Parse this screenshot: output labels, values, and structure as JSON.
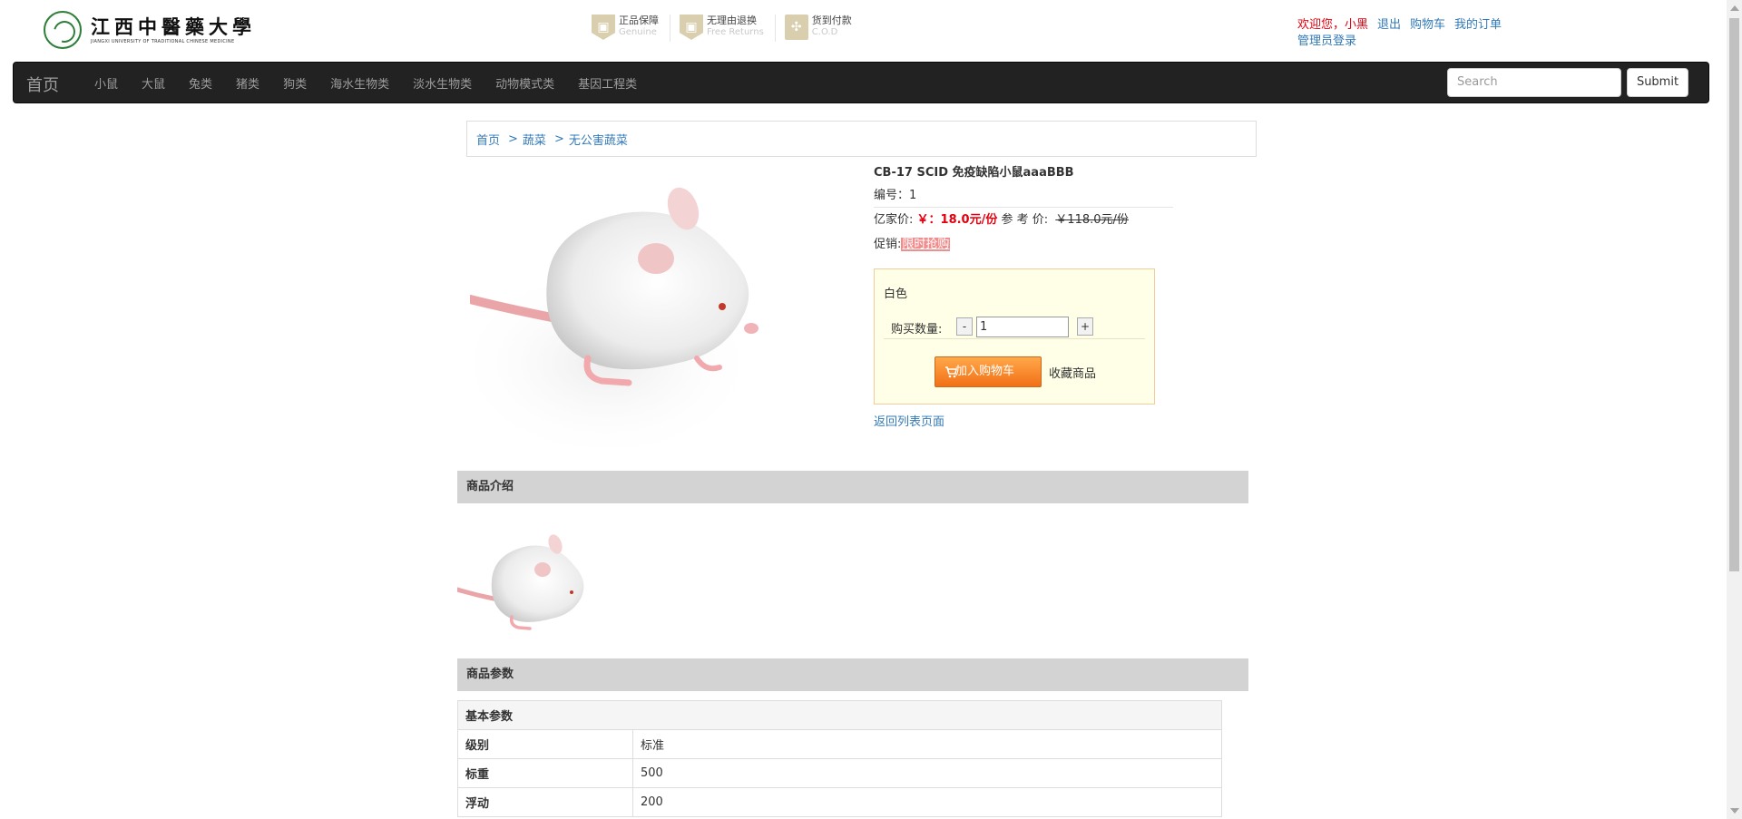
{
  "header": {
    "logo": {
      "name_cn": "江西中醫藥大學",
      "name_en": "JIANGXI UNIVERSITY OF TRADITIONAL CHINESE MEDICINE"
    },
    "guarantees": [
      {
        "icon": "shield-icon",
        "cn": "正品保障",
        "en": "Genuine"
      },
      {
        "icon": "shield-icon",
        "cn": "无理由退换",
        "en": "Free Returns"
      },
      {
        "icon": "cod-icon",
        "cn": "货到付款",
        "en": "C.O.D"
      }
    ],
    "user": {
      "welcome": "欢迎您，小黑",
      "logout": "退出",
      "cart": "购物车",
      "orders": "我的订单",
      "admin_login": "管理员登录"
    }
  },
  "navbar": {
    "brand": "首页",
    "items": [
      "小鼠",
      "大鼠",
      "兔类",
      "猪类",
      "狗类",
      "海水生物类",
      "淡水生物类",
      "动物模式类",
      "基因工程类"
    ],
    "search_placeholder": "Search",
    "submit": "Submit"
  },
  "breadcrumb": {
    "home": "首页",
    "sep1": ">",
    "level1": "蔬菜",
    "sep2": ">",
    "level2": "无公害蔬菜"
  },
  "product": {
    "title": "CB-17 SCID 免疫缺陷小鼠aaaBBB",
    "code_label": "编号：",
    "code": "1",
    "price_label": "亿家价:",
    "price": "￥：18.0元/份",
    "ref_label": "参 考 价:",
    "ref_price": "￥118.0元/份",
    "promo_label": "促销:",
    "promo": "限时抢购",
    "color": "白色",
    "qty_label": "购买数量:",
    "qty_minus": "-",
    "qty_value": "1",
    "qty_plus": "+",
    "add_to_cart": "加入购物车",
    "favorite": "收藏商品",
    "back_to_list": "返回列表页面"
  },
  "sections": {
    "intro": "商品介绍",
    "params": "商品参数"
  },
  "params_table": {
    "header": "基本参数",
    "rows": [
      {
        "k": "级别",
        "v": "标准"
      },
      {
        "k": "标重",
        "v": "500"
      },
      {
        "k": "浮动",
        "v": "200"
      }
    ]
  },
  "colors": {
    "nav_bg": "#222222",
    "price_red": "#e4000f",
    "link": "#337ab7",
    "buybox_bg": "#fffee6",
    "cart_orange": "#f27016"
  }
}
